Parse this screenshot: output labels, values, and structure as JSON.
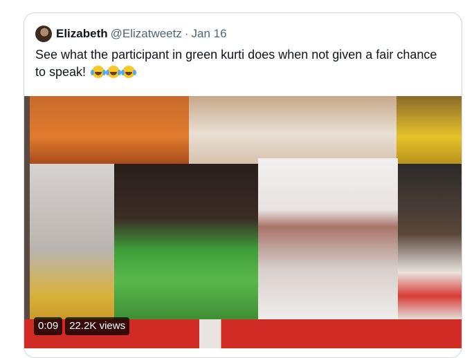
{
  "tweet": {
    "display_name": "Elizabeth",
    "handle": "@Elizatweetz",
    "separator": "·",
    "date": "Jan 16",
    "text": "See what the participant in green kurti does when not given a fair chance to speak!",
    "emoji_count": 3
  },
  "video": {
    "duration": "0:09",
    "views": "22.2K views"
  },
  "colors": {
    "link": "#1d9bf0",
    "border": "#cfd9de",
    "secondary_text": "#536471",
    "primary_text": "#0f1419"
  }
}
